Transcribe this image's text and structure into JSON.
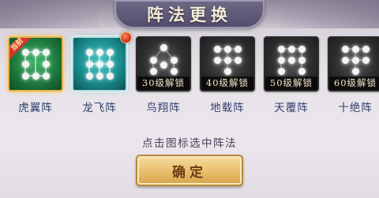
{
  "title": "阵法更换",
  "formations": [
    {
      "name": "虎翼阵",
      "state": "current",
      "badge": "当前",
      "lock_label": ""
    },
    {
      "name": "龙飞阵",
      "state": "learned",
      "badge": "",
      "lock_label": ""
    },
    {
      "name": "鸟翔阵",
      "state": "locked",
      "badge": "",
      "lock_label": "30级解锁"
    },
    {
      "name": "地载阵",
      "state": "locked",
      "badge": "",
      "lock_label": "40级解锁"
    },
    {
      "name": "天覆阵",
      "state": "locked",
      "badge": "",
      "lock_label": "50级解锁"
    },
    {
      "name": "十绝阵",
      "state": "locked",
      "badge": "",
      "lock_label": "60级解锁"
    }
  ],
  "hint": "点击图标选中阵法",
  "confirm_label": "确定",
  "colors": {
    "current_tile": "#1f7b3f",
    "learned_tile": "#1a8c8e",
    "locked_tile": "#2d2d2d",
    "button": "#e9be6b",
    "name_text": "#2f3f6d"
  }
}
